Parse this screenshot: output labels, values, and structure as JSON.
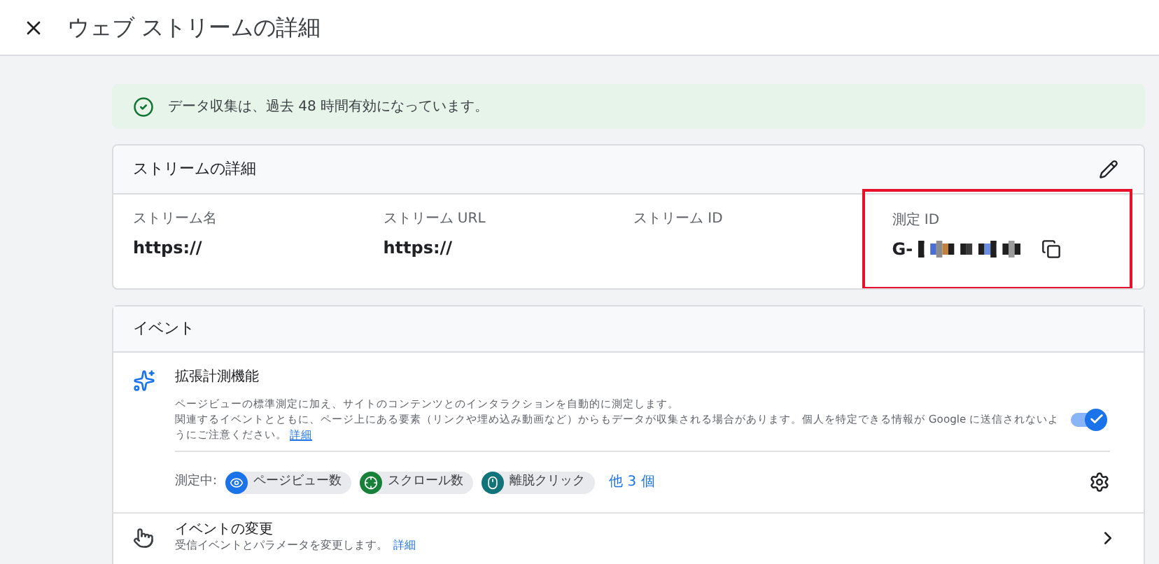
{
  "header": {
    "title": "ウェブ ストリームの詳細"
  },
  "alert": {
    "text": "データ収集は、過去 48 時間有効になっています。"
  },
  "stream_details": {
    "title": "ストリームの詳細",
    "fields": [
      {
        "label": "ストリーム名",
        "value": "https://",
        "highlighted": false,
        "redacted": false
      },
      {
        "label": "ストリーム URL",
        "value": "https://",
        "highlighted": false,
        "redacted": false
      },
      {
        "label": "ストリーム ID",
        "highlighted": false,
        "redacted": false
      },
      {
        "label": "測定 ID",
        "value": "G-",
        "highlighted": true,
        "redacted": true
      }
    ]
  },
  "events": {
    "title": "イベント",
    "enhanced_measurement": {
      "title": "拡張計測機能",
      "description_lines": [
        "ページビューの標準測定に加え、サイトのコンテンツとのインタラクションを自動的に測定します。",
        "関連するイベントとともに、ページ上にある要素（リンクや埋め込み動画など）からもデータが収集される場合があります。個人を特定できる情報が Google に送信されないようにご注意ください。"
      ],
      "link": "詳細",
      "on": true,
      "measuring_label": "測定中:",
      "chips": [
        {
          "kind": "eye",
          "label": "ページビュー数",
          "color": "#1a73e8"
        },
        {
          "kind": "scroll",
          "label": "スクロール数",
          "color": "#188038"
        },
        {
          "kind": "mouse",
          "label": "離脱クリック",
          "color": "#12737a"
        }
      ],
      "more": "他 3 個"
    },
    "modify": {
      "title": "イベントの変更",
      "description": "受信イベントとパラメータを変更します。",
      "link": "詳細"
    }
  }
}
